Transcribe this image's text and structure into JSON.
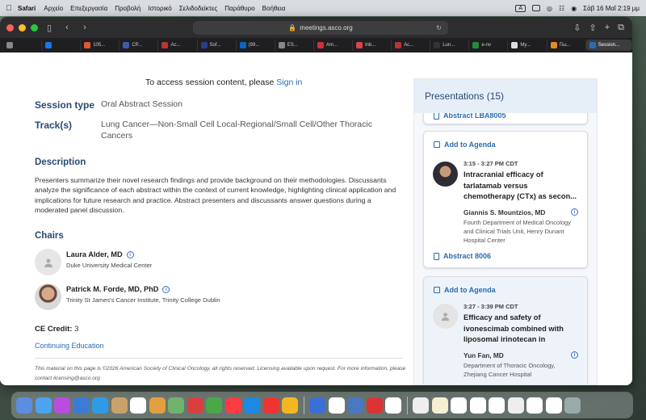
{
  "menubar": {
    "app": "Safari",
    "menus": [
      "Αρχείο",
      "Επεξεργασία",
      "Προβολή",
      "Ιστορικό",
      "Σελιδοδείκτες",
      "Παράθυρο",
      "Βοήθεια"
    ],
    "input_indicator": "A",
    "clock": "Σάβ 16 Μαΐ  2:19 μμ"
  },
  "browser": {
    "url": "meetings.asco.org",
    "tabs": [
      {
        "label": "105...",
        "color": "#e45735"
      },
      {
        "label": "CP...",
        "color": "#3b5ca8"
      },
      {
        "label": "Ac...",
        "color": "#b33"
      },
      {
        "label": "Sof...",
        "color": "#2b3a8a"
      },
      {
        "label": "(99...",
        "color": "#0a66c2"
      },
      {
        "label": "ES...",
        "color": "#888"
      },
      {
        "label": "Am...",
        "color": "#c33"
      },
      {
        "label": "Inb...",
        "color": "#d44"
      },
      {
        "label": "Ac...",
        "color": "#b33"
      },
      {
        "label": "Lun...",
        "color": "#333"
      },
      {
        "label": "e-nv",
        "color": "#2a8a3a"
      },
      {
        "label": "My...",
        "color": "#ddd"
      },
      {
        "label": "Πω...",
        "color": "#e58a2a"
      },
      {
        "label": "Session...",
        "color": "#2b6cb0"
      }
    ]
  },
  "page": {
    "signin_prefix": "To access session content, please ",
    "signin_link": "Sign in",
    "session_type_label": "Session type",
    "session_type_value": "Oral Abstract Session",
    "tracks_label": "Track(s)",
    "tracks_value": "Lung Cancer—Non-Small Cell Local-Regional/Small Cell/Other Thoracic Cancers",
    "description_heading": "Description",
    "description_text": "Presenters summarize their novel research findings and provide background on their methodologies. Discussants analyze the significance of each abstract within the context of current knowledge, highlighting clinical application and implications for future research and practice. Abstract presenters and discussants answer questions during a moderated panel discussion.",
    "chairs_heading": "Chairs",
    "chairs": [
      {
        "name": "Laura Alder,  MD",
        "org": "Duke University Medical Center"
      },
      {
        "name": "Patrick M. Forde, MD, PhD",
        "org": "Trinity St James's Cancer Institute, Trinity College Dublin"
      }
    ],
    "ce_label": "CE Credit:",
    "ce_value": "3",
    "continuing_education": "Continuing Education",
    "footer": "This material on this page is ©2026 American Society of Clinical Oncology, all rights reserved. Licensing available upon request. For more information, please contact licensing@asco.org"
  },
  "presentations": {
    "heading": "Presentations (15)",
    "partial_abstract": "Abstract LBA8005",
    "items": [
      {
        "add_label": "Add to Agenda",
        "time": "3:15 - 3:27 PM CDT",
        "title": "Intracranial efficacy of tarlatamab versus chemotherapy (CTx) as secon...",
        "presenter": "Giannis S. Mountzios, MD",
        "org": "Fourth Department of Medical Oncology and Clinical Trials Unit, Henry Dunant Hospital Center",
        "abstract": "Abstract 8006"
      },
      {
        "add_label": "Add to Agenda",
        "time": "3:27 - 3:39 PM CDT",
        "title": "Efficacy and safety of ivonescimab combined with liposomal irinotecan in patient...",
        "presenter": "Yun Fan, MD",
        "org": "Department of Thoracic Oncology, Zhejiang Cancer Hospital"
      }
    ]
  },
  "dock": {
    "apps": [
      "#5b8de0",
      "#4da3f0",
      "#b84de0",
      "#3a7bd5",
      "#2f9be8",
      "#c8a26a",
      "#ffffff",
      "#e0a040",
      "#6fb36f",
      "#d84040",
      "#49a949",
      "#fc3c44",
      "#1e88e5",
      "#e33",
      "#f5b623",
      "#3b6fd8",
      "#ffffff",
      "#4a78c0",
      "#d33",
      "#ffffff"
    ],
    "tray": [
      "#eee",
      "#f5f0d0",
      "#fff",
      "#fff",
      "#fff",
      "#eee",
      "#fff",
      "#fff",
      "#eee"
    ]
  }
}
